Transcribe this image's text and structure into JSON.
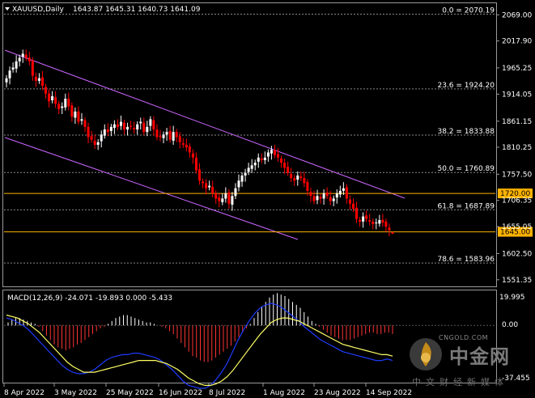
{
  "header": {
    "symbol_label": "XAUUSD,Daily",
    "ohlc": "1643.87 1645.31 1640.73 1641.09"
  },
  "price_axis": {
    "labels": [
      "2069.00",
      "2017.90",
      "1965.25",
      "1914.05",
      "1861.15",
      "1810.25",
      "1757.50",
      "1706.35",
      "1655.05",
      "1602.50",
      "1551.35"
    ]
  },
  "fibonacci": [
    {
      "label": "0.0 = 2070.19",
      "price": 2070.19
    },
    {
      "label": "23.6 = 1924.20",
      "price": 1924.2
    },
    {
      "label": "38.2 = 1833.88",
      "price": 1833.88
    },
    {
      "label": "50.0 = 1760.89",
      "price": 1760.89
    },
    {
      "label": "61.8 = 1687.89",
      "price": 1687.89
    },
    {
      "label": "78.6 = 1583.96",
      "price": 1583.96
    }
  ],
  "horizontal_lines": [
    {
      "label": "1720.00",
      "price": 1720.0
    },
    {
      "label": "1645.00",
      "price": 1645.0
    }
  ],
  "macd": {
    "label": "MACD(12,26,9) -24.071 -19.893 0.000 -5.433",
    "axis_labels": [
      "19.995",
      "0.00",
      "-37.455"
    ]
  },
  "time_axis": {
    "labels": [
      "8 Apr 2022",
      "3 May 2022",
      "25 May 2022",
      "16 Jun 2022",
      "8 Jul 2022",
      "1 Aug 2022",
      "23 Aug 2022",
      "14 Sep 2022"
    ]
  },
  "watermark": {
    "brand": "中金网",
    "site": "CNGOLD.COM",
    "sub": "中文财经新媒体"
  },
  "colors": {
    "background": "#000000",
    "bull_candle": "#ffffff",
    "bear_candle": "#ff0000",
    "channel": "#cc66ff",
    "level_line": "#ffb300",
    "fib_line": "#8a8a8a",
    "macd_line": "#1e3cff",
    "signal_line": "#ffff66",
    "osma_up": "#ffffff",
    "osma_down": "#ff3333"
  },
  "chart_data": {
    "type": "candlestick",
    "symbol": "XAUUSD",
    "timeframe": "Daily",
    "ylim": [
      1540,
      2090
    ],
    "x_start": "2022-04-08",
    "x_end": "2022-09-23",
    "candles_close": [
      1945,
      1960,
      1966,
      1978,
      1985,
      1993,
      1985,
      1978,
      1950,
      1940,
      1945,
      1930,
      1915,
      1900,
      1910,
      1895,
      1885,
      1890,
      1905,
      1890,
      1870,
      1880,
      1860,
      1865,
      1850,
      1830,
      1825,
      1815,
      1820,
      1835,
      1845,
      1840,
      1850,
      1855,
      1850,
      1860,
      1845,
      1850,
      1850,
      1845,
      1855,
      1860,
      1840,
      1850,
      1865,
      1845,
      1830,
      1830,
      1835,
      1840,
      1825,
      1840,
      1830,
      1820,
      1815,
      1810,
      1800,
      1790,
      1765,
      1745,
      1740,
      1730,
      1735,
      1720,
      1710,
      1705,
      1710,
      1720,
      1700,
      1715,
      1730,
      1745,
      1755,
      1760,
      1770,
      1775,
      1780,
      1790,
      1785,
      1790,
      1800,
      1805,
      1795,
      1790,
      1780,
      1770,
      1760,
      1750,
      1745,
      1755,
      1750,
      1740,
      1725,
      1715,
      1705,
      1715,
      1710,
      1720,
      1715,
      1705,
      1710,
      1720,
      1725,
      1730,
      1710,
      1700,
      1690,
      1670,
      1665,
      1675,
      1670,
      1665,
      1660,
      1663,
      1668,
      1663,
      1655,
      1648,
      1641.09
    ],
    "last_candle": {
      "open": 1643.87,
      "high": 1645.31,
      "low": 1640.73,
      "close": 1641.09
    },
    "macd_histogram": [
      2,
      4,
      5,
      5,
      4,
      3,
      2,
      1,
      -1,
      -4,
      -7,
      -10,
      -13,
      -15,
      -16,
      -17,
      -16,
      -15,
      -13,
      -12,
      -10,
      -8,
      -6,
      -4,
      -2,
      -1,
      1,
      3,
      5,
      6,
      7,
      7,
      6,
      5,
      4,
      3,
      2,
      2,
      1,
      0,
      -1,
      -2,
      -4,
      -6,
      -9,
      -12,
      -15,
      -18,
      -21,
      -22,
      -24,
      -25,
      -25,
      -24,
      -22,
      -20,
      -18,
      -16,
      -14,
      -11,
      -8,
      -5,
      -2,
      1,
      5,
      9,
      13,
      16,
      19,
      21,
      22,
      21,
      20,
      18,
      16,
      14,
      12,
      9,
      6,
      3,
      1,
      -1,
      -3,
      -5,
      -7,
      -8,
      -9,
      -10,
      -10,
      -10,
      -9,
      -8,
      -7,
      -6,
      -5,
      -5,
      -6,
      -6,
      -5,
      -5,
      -6
    ],
    "macd_line": [
      5,
      4,
      2,
      0,
      -3,
      -7,
      -11,
      -15,
      -19,
      -23,
      -27,
      -30,
      -32,
      -33,
      -33,
      -32,
      -30,
      -27,
      -24,
      -22,
      -21,
      -20,
      -20,
      -19,
      -19,
      -20,
      -21,
      -22,
      -24,
      -27,
      -30,
      -34,
      -38,
      -41,
      -42,
      -43,
      -43,
      -41,
      -37,
      -32,
      -26,
      -18,
      -10,
      -3,
      3,
      8,
      12,
      14,
      15,
      14,
      12,
      9,
      6,
      3,
      -1,
      -4,
      -7,
      -10,
      -12,
      -14,
      -16,
      -18,
      -19,
      -20,
      -21,
      -22,
      -23,
      -24,
      -24,
      -23,
      -24
    ],
    "signal_line": [
      7,
      6,
      5,
      3,
      1,
      -2,
      -5,
      -9,
      -13,
      -17,
      -21,
      -25,
      -28,
      -30,
      -32,
      -32,
      -32,
      -31,
      -30,
      -29,
      -28,
      -27,
      -26,
      -25,
      -24,
      -24,
      -24,
      -24,
      -25,
      -26,
      -28,
      -30,
      -33,
      -36,
      -38,
      -40,
      -41,
      -41,
      -40,
      -38,
      -35,
      -31,
      -26,
      -21,
      -16,
      -11,
      -6,
      -2,
      2,
      4,
      5,
      5,
      4,
      3,
      1,
      -1,
      -3,
      -5,
      -7,
      -9,
      -11,
      -13,
      -14,
      -15,
      -16,
      -17,
      -18,
      -19,
      -20,
      -20,
      -21
    ]
  }
}
